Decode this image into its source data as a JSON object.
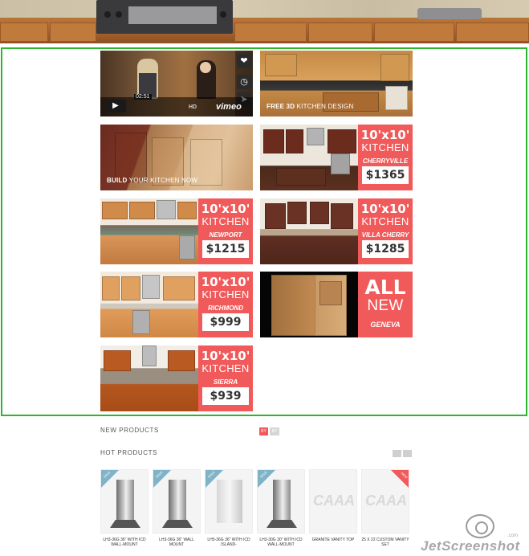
{
  "video": {
    "time": "02:51",
    "quality": "HD",
    "brand": "vimeo",
    "play_icon": "play-icon",
    "like_icon": "heart-icon",
    "later_icon": "clock-icon",
    "share_icon": "share-icon"
  },
  "design_tile": {
    "bold": "FREE 3D",
    "rest": "KITCHEN DESIGN"
  },
  "build_tile": {
    "bold": "BUILD",
    "rest": "YOUR KITCHEN NOW"
  },
  "promos": [
    {
      "size": "10'x10'",
      "word": "KITCHEN",
      "name": "CHERRYVILLE",
      "price": "$1365"
    },
    {
      "size": "10'x10'",
      "word": "KITCHEN",
      "name": "NEWPORT",
      "price": "$1215"
    },
    {
      "size": "10'x10'",
      "word": "KITCHEN",
      "name": "VILLA CHERRY",
      "price": "$1285"
    },
    {
      "size": "10'x10'",
      "word": "KITCHEN",
      "name": "RICHMOND",
      "price": "$999"
    },
    {
      "size": "10'x10'",
      "word": "KITCHEN",
      "name": "Sierra",
      "price": "$939"
    }
  ],
  "geneva": {
    "big": "ALL",
    "word": "NEW",
    "name": "GENEVA"
  },
  "sections": {
    "new_products": "NEW PRODUCTS",
    "hot_products": "HOT PRODUCTS",
    "pill_left": "BY",
    "pill_right": "BY"
  },
  "products": [
    {
      "tag": "SALE",
      "name": "LH3-36G 36\" WITH ICD WALL-MOUNT",
      "kind": "hood"
    },
    {
      "tag": "SALE",
      "name": "LH3-36G 36\" WALL MOUNT",
      "kind": "hood"
    },
    {
      "tag": "SALE",
      "name": "LH5-36G 36\" WITH ICD ISLAND-",
      "kind": "hood"
    },
    {
      "tag": "SALE",
      "name": "LH3-30G 30\" WITH ICD WALL-MOUNT",
      "kind": "hood"
    },
    {
      "tag": "",
      "name": "GRANITE VANITY TOP",
      "kind": "logo"
    },
    {
      "tag": "NEW",
      "name": "25 X 22 CUSTOM VANITY SET",
      "kind": "logo"
    }
  ],
  "product_logo_text": "CAAA",
  "watermark": {
    "text": "JetScreenshot",
    "suffix": ".com"
  },
  "colors": {
    "accent": "#f15a5a",
    "outline": "#2db52d",
    "sale_corner": "#7fb3c8"
  }
}
